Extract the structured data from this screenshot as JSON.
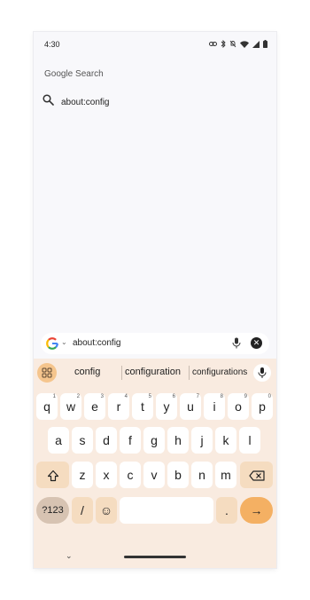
{
  "status": {
    "time": "4:30",
    "icons": [
      "link-icon",
      "bluetooth-icon",
      "bell-off-icon",
      "wifi-icon",
      "signal-icon",
      "battery-icon"
    ]
  },
  "results": {
    "section_title": "Google Search",
    "suggestion": "about:config"
  },
  "searchbar": {
    "query": "about:config"
  },
  "keyboard": {
    "suggestions": [
      "config",
      "configuration",
      "configurations"
    ],
    "row1": [
      {
        "label": "q",
        "hint": "1"
      },
      {
        "label": "w",
        "hint": "2"
      },
      {
        "label": "e",
        "hint": "3"
      },
      {
        "label": "r",
        "hint": "4"
      },
      {
        "label": "t",
        "hint": "5"
      },
      {
        "label": "y",
        "hint": "6"
      },
      {
        "label": "u",
        "hint": "7"
      },
      {
        "label": "i",
        "hint": "8"
      },
      {
        "label": "o",
        "hint": "9"
      },
      {
        "label": "p",
        "hint": "0"
      }
    ],
    "row2": [
      "a",
      "s",
      "d",
      "f",
      "g",
      "h",
      "j",
      "k",
      "l"
    ],
    "row3": [
      "z",
      "x",
      "c",
      "v",
      "b",
      "n",
      "m"
    ],
    "sym_label": "?123",
    "slash_label": "/",
    "period_label": ".",
    "emoji_glyph": "☺",
    "enter_glyph": "→",
    "shift_glyph": "⇧",
    "backspace_glyph": "⌫"
  },
  "nav": {
    "hide_glyph": "⌄"
  },
  "colors": {
    "keyboard_bg": "#f9ebe0",
    "accent": "#f4b063",
    "mod_key": "#f5dcc0"
  }
}
